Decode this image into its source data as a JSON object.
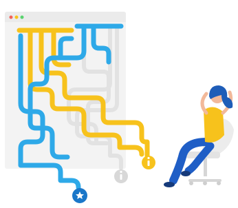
{
  "colors": {
    "blue": "#2ea9e8",
    "blue_dark": "#1a77c9",
    "yellow": "#f7c21c",
    "gray_light": "#e6e6e6",
    "window_bg": "#f2f2f2",
    "window_header": "#e9e9e9",
    "dot_red": "#f3625a",
    "dot_yellow": "#f7c21c",
    "dot_green": "#5ad36f",
    "woman_hair": "#1e5db8",
    "woman_top": "#f7c21c",
    "woman_pants": "#1f5ec6",
    "chair": "#e9e9e9"
  },
  "icons": [
    "browser-window-icon",
    "window-dot-red-icon",
    "window-dot-yellow-icon",
    "window-dot-green-icon",
    "star-badge-icon",
    "info-badge-gray-icon",
    "info-badge-yellow-icon",
    "woman-relaxing-illustration",
    "office-chair-icon"
  ]
}
